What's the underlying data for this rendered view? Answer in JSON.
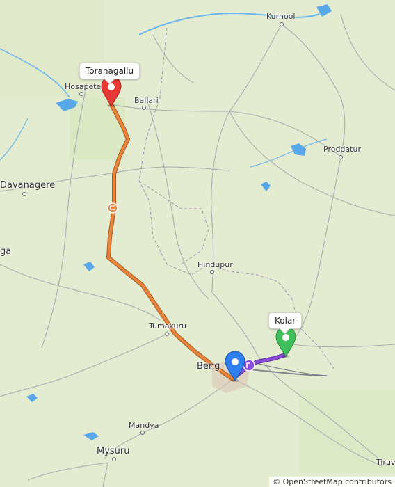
{
  "map": {
    "towns": [
      {
        "name": "Kurnool"
      },
      {
        "name": "Hosapete"
      },
      {
        "name": "Ballari"
      },
      {
        "name": "Proddatur"
      },
      {
        "name": "Davanagere"
      },
      {
        "name": "ga"
      },
      {
        "name": "Hindupur"
      },
      {
        "name": "Tumakuru"
      },
      {
        "name": "Beng"
      },
      {
        "name": "Mandya"
      },
      {
        "name": "Mysuru"
      },
      {
        "name": "Tiruv"
      }
    ],
    "origin_label": "Toranagallu",
    "destination_label": "Kolar",
    "attribution": "© OpenStreetMap contributors",
    "colors": {
      "route_main": "#e8843b",
      "route_end": "#8a4bd6",
      "origin_pin": "#e53935",
      "destination_pin": "#3fbf5a",
      "location_pin": "#2f7ff0",
      "water": "#58a7e8"
    }
  }
}
